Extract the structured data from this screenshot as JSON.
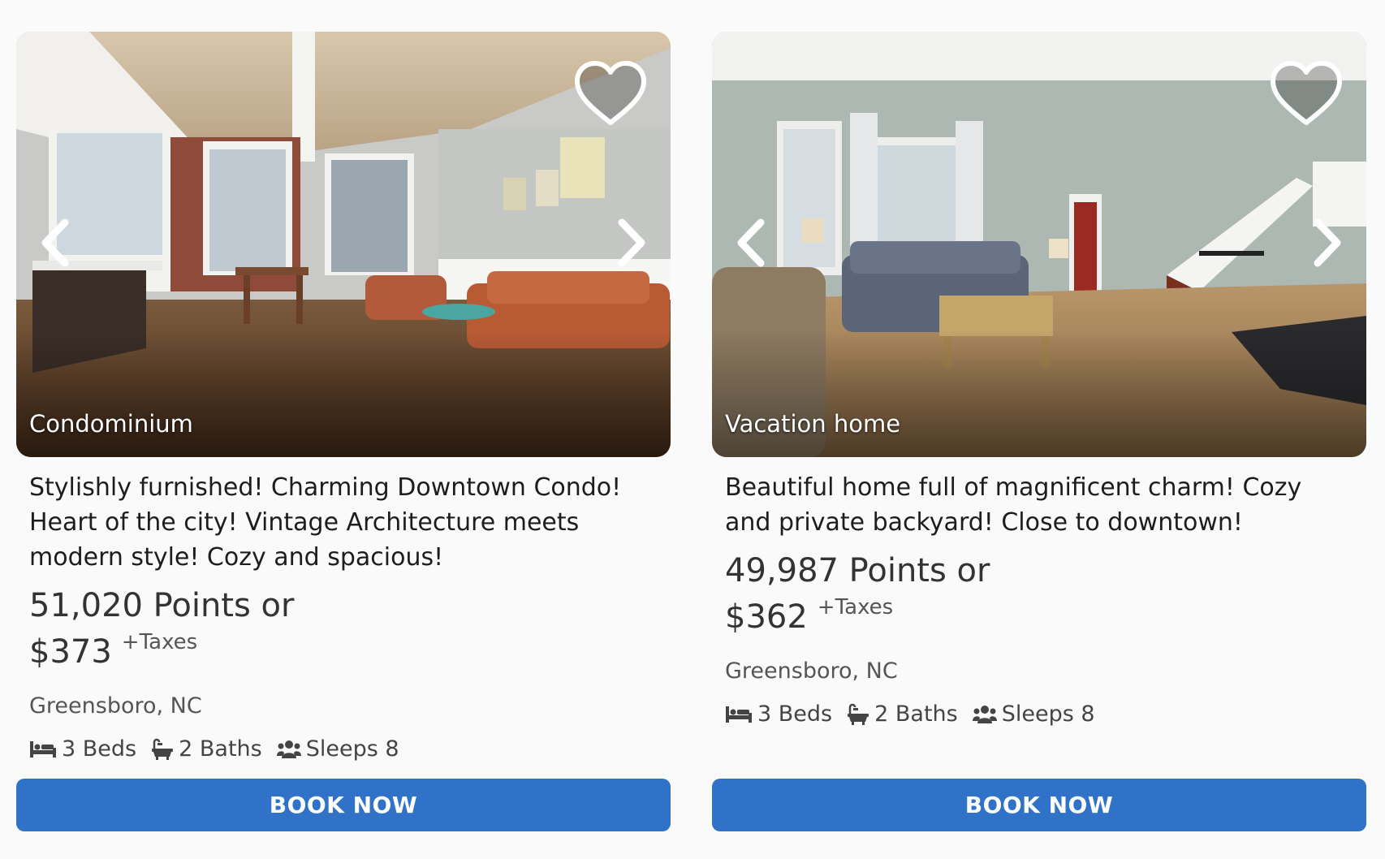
{
  "listings": [
    {
      "property_type": "Condominium",
      "title": "Stylishly furnished! Charming Downtown Condo! Heart of the city! Vintage Architecture meets modern style! Cozy and spacious!",
      "points": "51,020 Points or",
      "price": "$373",
      "taxes": "+Taxes",
      "location": "Greensboro, NC",
      "beds": "3 Beds",
      "baths": "2 Baths",
      "sleeps": "Sleeps 8",
      "book_label": "BOOK NOW"
    },
    {
      "property_type": "Vacation home",
      "title": "Beautiful home full of magnificent charm! Cozy and private backyard! Close to downtown!",
      "points": "49,987 Points or",
      "price": "$362",
      "taxes": "+Taxes",
      "location": "Greensboro, NC",
      "beds": "3 Beds",
      "baths": "2 Baths",
      "sleeps": "Sleeps 8",
      "book_label": "BOOK NOW"
    }
  ],
  "colors": {
    "accent": "#2f72c8",
    "background": "#fafafa",
    "text": "#1d1d1d",
    "muted": "#555555"
  },
  "icons": [
    "heart-icon",
    "chevron-left-icon",
    "chevron-right-icon",
    "bed-icon",
    "bath-icon",
    "people-icon"
  ]
}
